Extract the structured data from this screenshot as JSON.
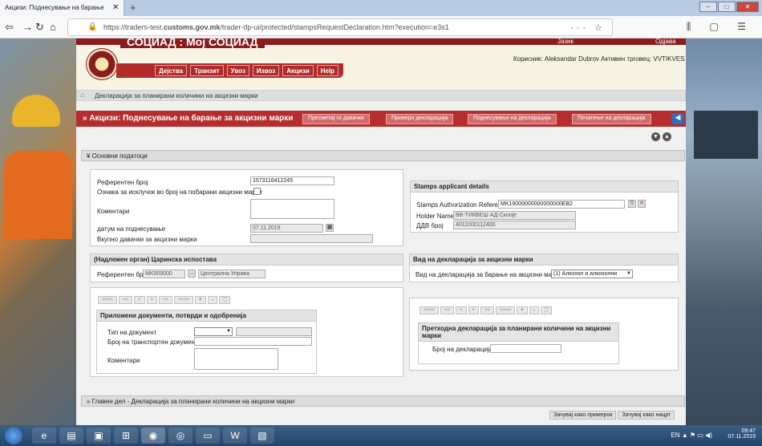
{
  "browser": {
    "tab_title": "Акцизи: Поднесување на барање",
    "url_prefix": "https://traders-test.",
    "url_domain": "customs.gov.mk",
    "url_path": "/trader-dp-ui/protected/stampsRequestDeclaration.htm?execution=e3s1"
  },
  "site": {
    "title": "СОЦИАД : Мој СОЦИАД",
    "language_label": "Јазик",
    "logout_label": "Одјава",
    "user_label": "Корисник: Aleksandar Dubrov  Активен трговец: VVTIKVES"
  },
  "menu": [
    "Дејства",
    "Транзит",
    "Увоз",
    "Извоз",
    "Акцизи",
    "Help"
  ],
  "breadcrumb": "Декларација за планирани количини на акцизни марки",
  "page_title": "» Акцизи: Поднесување на барање за акцизни марки",
  "actions": [
    "Пресметај ги давачки",
    "Провери декларација",
    "Поднесување на декларација",
    "Печатење на декларација"
  ],
  "sections": {
    "basic": "Основни податоци",
    "main": "Главен дел - Декларација за планирани количини на акцизни марки"
  },
  "basic_form": {
    "ref_number_label": "Референтен број",
    "ref_number_value": "1573116412245",
    "exception_label": "Ознака за исклучок во број на побарани акцизни марки",
    "comments_label": "Коментари",
    "submit_date_label": "датум на поднесување",
    "submit_date_value": "07.11.2019",
    "total_duties_label": "Вкупно давачки за акцизни марки"
  },
  "applicant": {
    "title": "Stamps applicant details",
    "auth_ref_label": "Stamps Authorization Reference",
    "auth_ref_value": "MK19000000000000000EB2",
    "holder_label": "Holder Name",
    "holder_value": "ВВ-ТИКВЕШ АД-Скопје",
    "vat_label": "ДДВ број",
    "vat_value": "4011000112400"
  },
  "authority": {
    "title": "(Надлежен орган) Царинска испостава",
    "ref_label": "Референтен број",
    "ref_value": "MK009000",
    "name_value": "Централна Управа"
  },
  "decl_type": {
    "title": "Вид на декларација за акцизни марки",
    "label": "Вид на декларација за барање на акцизни марки",
    "selected": "(1) Алкохол и алкохолни"
  },
  "pager": [
    "<<<<",
    "<<",
    "<",
    ">",
    ">>",
    ">>>>",
    "+",
    "-"
  ],
  "attached": {
    "title": "Приложени документи, потврди и одобренија",
    "doc_type_label": "Тип на документ",
    "transport_label": "Број на транспортен документ",
    "comments_label": "Коментари"
  },
  "previous": {
    "title": "Претходна декларација за планирани количини на акцизни марки",
    "decl_number_label": "Број на декларација"
  },
  "footer": [
    "Зачувај како примерок",
    "Зачувај како нацрт"
  ],
  "taskbar": {
    "lang": "EN",
    "time": "09:47",
    "date": "07.11.2019"
  }
}
